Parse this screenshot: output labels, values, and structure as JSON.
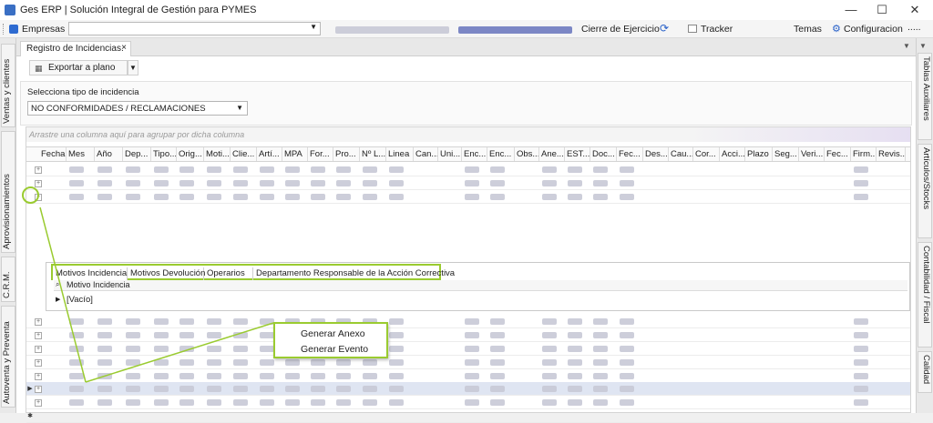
{
  "window": {
    "title": "Ges ERP | Solución Integral de Gestión para PYMES",
    "minimize_icon": "minimize-icon",
    "maximize_icon": "maximize-icon",
    "close_icon": "close-icon"
  },
  "toolbar": {
    "empresas_label": "Empresas",
    "cierre_label": "Cierre de Ejercicio",
    "tracker_label": "Tracker",
    "temas_label": "Temas",
    "configuracion_label": "Configuracion",
    "ellipsis_label": "....."
  },
  "left_sidebar": [
    {
      "label": "Ventas y clientes"
    },
    {
      "label": "Aprovisionamientos"
    },
    {
      "label": "C.R.M."
    },
    {
      "label": "Autoventa y Preventa"
    }
  ],
  "right_sidebar": [
    {
      "label": "Tablas Auxiliares"
    },
    {
      "label": "Artículos/Stocks"
    },
    {
      "label": "Contabilidad / Fiscal"
    },
    {
      "label": "Calidad"
    }
  ],
  "doc_tab": {
    "label": "Registro de Incidencias.",
    "close": "×"
  },
  "export": {
    "label": "Exportar a plano"
  },
  "filter": {
    "label": "Selecciona tipo de incidencia",
    "selected": "NO CONFORMIDADES / RECLAMACIONES"
  },
  "grid": {
    "group_hint": "Arrastre una columna aquí para agrupar por dicha columna",
    "columns": [
      "Fecha",
      "Mes",
      "Año",
      "Dep...",
      "Tipo...",
      "Orig...",
      "Moti...",
      "Clie...",
      "Artí...",
      "MPA",
      "For...",
      "Pro...",
      "Nº L...",
      "Linea",
      "Can...",
      "Uni...",
      "Enc...",
      "Enc...",
      "Obs...",
      "Ane...",
      "EST...",
      "Doc...",
      "Fec...",
      "Des...",
      "Cau...",
      "Cor...",
      "Acci...",
      "Plazo",
      "Seg...",
      "Veri...",
      "Fec...",
      "Firm...",
      "Revis..."
    ]
  },
  "detail": {
    "tabs": [
      "Motivos Incidencia",
      "Motivos Devolución",
      "Operarios",
      "Departamento Responsable de la Acción Correctiva"
    ],
    "column": "Motivo Incidencia",
    "value": "[Vacío]"
  },
  "context_menu": {
    "items": [
      "Generar Anexo",
      "Generar Evento"
    ]
  },
  "colors": {
    "highlight": "#9acb30",
    "selected_row": "#dfe5f2"
  }
}
